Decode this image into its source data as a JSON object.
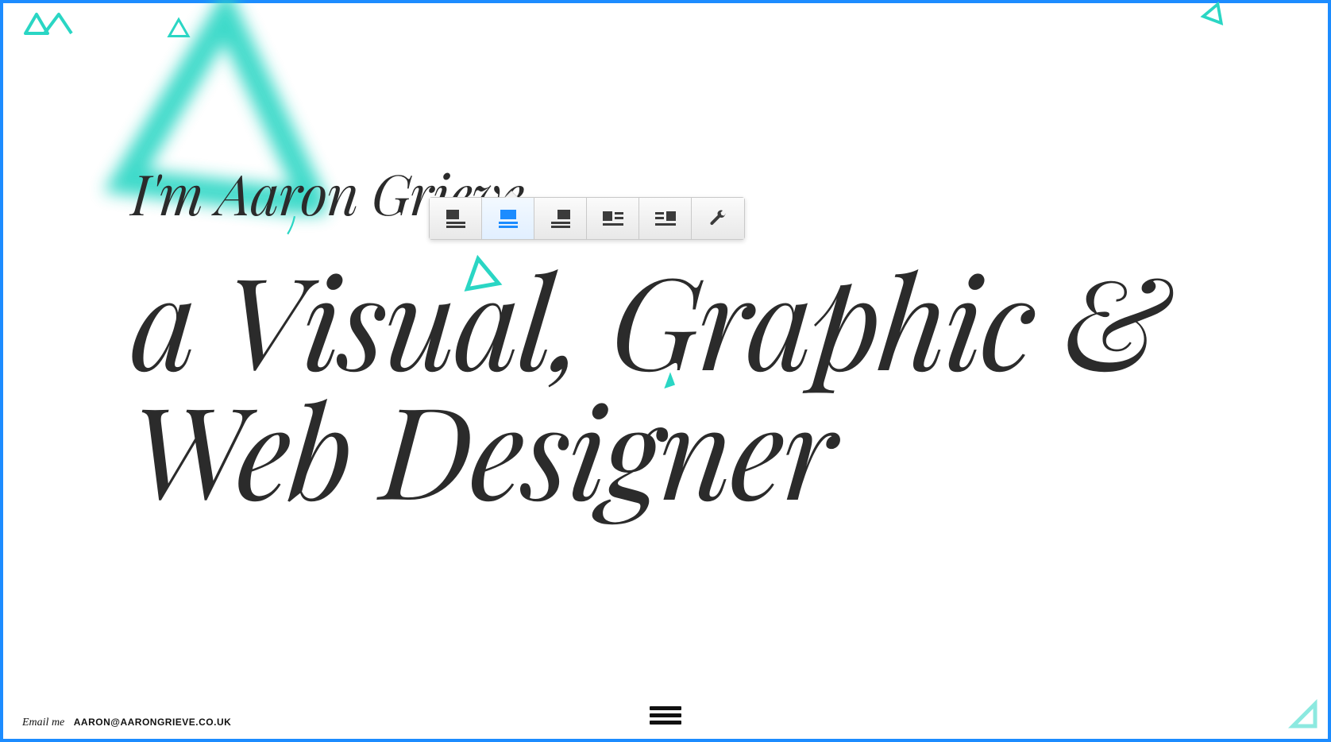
{
  "colors": {
    "accent": "#1c8cff",
    "teal": "#2ad6c4",
    "ink": "#2b2b2b"
  },
  "logo": {
    "name": "ag-monogram"
  },
  "hero": {
    "line1": "I'm Aaron Grieve,",
    "line2": "a Visual, Graphic & Web Designer"
  },
  "toolbar": {
    "buttons": [
      {
        "name": "align-left",
        "active": false
      },
      {
        "name": "align-center",
        "active": true
      },
      {
        "name": "align-right",
        "active": false
      },
      {
        "name": "float-left",
        "active": false
      },
      {
        "name": "float-right",
        "active": false
      },
      {
        "name": "settings",
        "active": false
      }
    ]
  },
  "footer": {
    "label": "Email me",
    "email": "AARON@AARONGRIEVE.CO.UK"
  },
  "menu": {
    "name": "main-menu"
  }
}
